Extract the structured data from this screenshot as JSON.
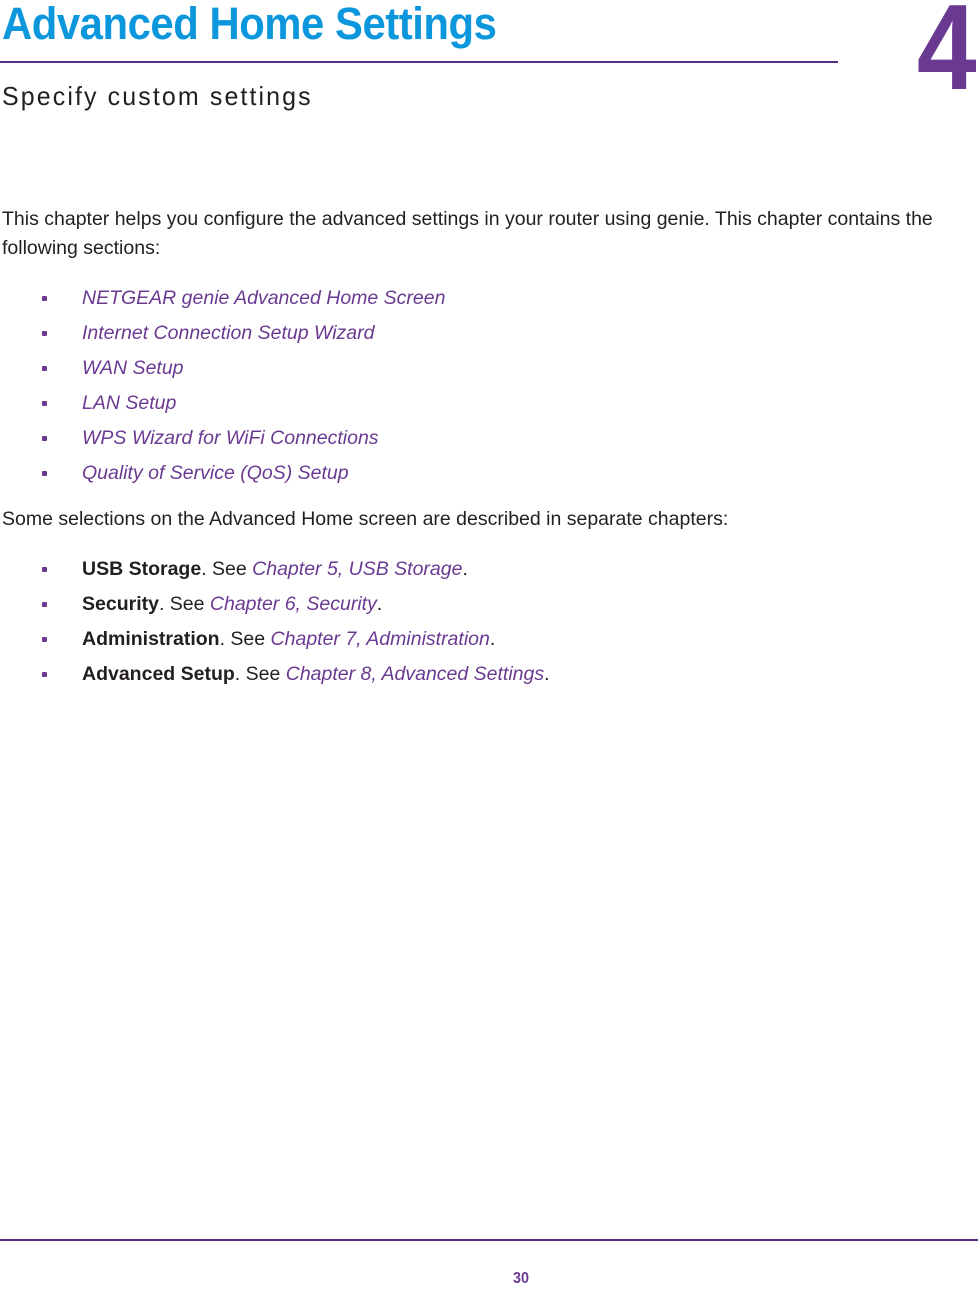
{
  "chapter": {
    "title": "Advanced Home Settings",
    "number": "4",
    "subtitle": "Specify custom settings"
  },
  "intro": {
    "paragraph": "This chapter helps you configure the advanced settings in your router using genie. This chapter contains the following sections:"
  },
  "sections_list": [
    {
      "label": "NETGEAR genie Advanced Home Screen"
    },
    {
      "label": "Internet Connection Setup Wizard"
    },
    {
      "label": "WAN Setup"
    },
    {
      "label": "LAN Setup"
    },
    {
      "label": "WPS Wizard for WiFi Connections"
    },
    {
      "label": "Quality of Service (QoS) Setup"
    }
  ],
  "separate_chapters": {
    "paragraph": "Some selections on the Advanced Home screen are described in separate chapters:",
    "items": [
      {
        "term": "USB Storage",
        "connector": ". See ",
        "xref": "Chapter 5, USB Storage",
        "suffix": "."
      },
      {
        "term": "Security",
        "connector": ". See ",
        "xref": "Chapter 6, Security",
        "suffix": "."
      },
      {
        "term": "Administration",
        "connector": ". See ",
        "xref": "Chapter 7, Administration",
        "suffix": "."
      },
      {
        "term": "Advanced Setup",
        "connector": ". See ",
        "xref": "Chapter 8, Advanced Settings",
        "suffix": "."
      }
    ]
  },
  "footer": {
    "page_number": "30"
  },
  "colors": {
    "title_blue": "#0c97dd",
    "accent_purple": "#6a3a92",
    "rule_purple": "#5b2d82",
    "body_text": "#231f20"
  }
}
